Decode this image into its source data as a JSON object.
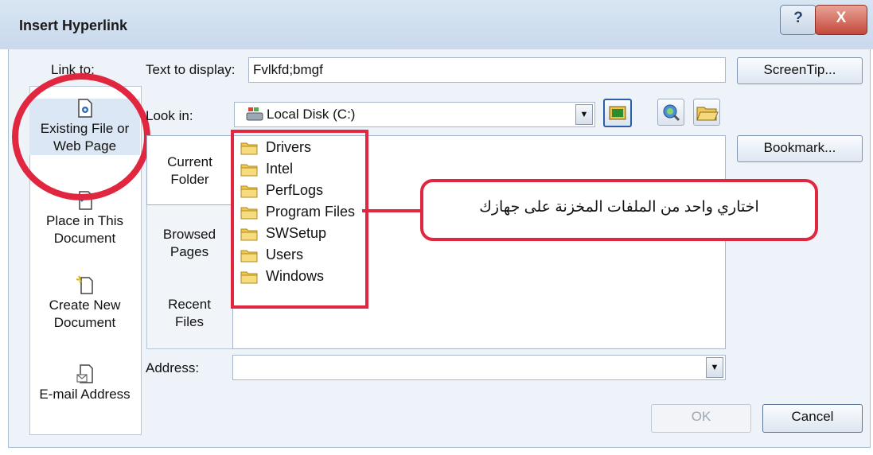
{
  "window": {
    "title": "Insert Hyperlink",
    "help_glyph": "?",
    "close_glyph": "X"
  },
  "sidebar": {
    "label": "Link to:",
    "items": [
      {
        "line1": "Existing File or",
        "line2": "Web Page",
        "icon": "document-globe-icon"
      },
      {
        "line1": "Place in This",
        "line2": "Document",
        "icon": "document-place-icon"
      },
      {
        "line1": "Create New",
        "line2": "Document",
        "icon": "new-document-icon"
      },
      {
        "line1": "E-mail Address",
        "line2": "",
        "icon": "email-icon"
      }
    ]
  },
  "text_to_display": {
    "label": "Text to display:",
    "value": "Fvlkfd;bmgf"
  },
  "buttons": {
    "screentip": "ScreenTip...",
    "bookmark": "Bookmark...",
    "ok": "OK",
    "cancel": "Cancel"
  },
  "look_in": {
    "label": "Look in:",
    "value": "Local Disk (C:)",
    "dropdown_glyph": "▼"
  },
  "tabs": [
    {
      "line1": "Current",
      "line2": "Folder"
    },
    {
      "line1": "Browsed",
      "line2": "Pages"
    },
    {
      "line1": "Recent",
      "line2": "Files"
    }
  ],
  "files": [
    "Drivers",
    "Intel",
    "PerfLogs",
    "Program Files",
    "SWSetup",
    "Users",
    "Windows"
  ],
  "callout": {
    "text": "اختاري واحد من الملفات المخزنة على جهازك"
  },
  "address": {
    "label": "Address:",
    "value": "",
    "dropdown_glyph": "▼"
  },
  "colors": {
    "annotation_red": "#e0273f",
    "selection_blue": "#dbe7f5",
    "folder_yellow": "#f2c94c"
  }
}
